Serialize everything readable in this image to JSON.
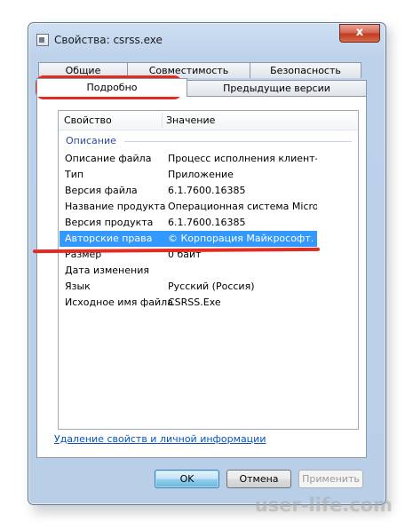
{
  "window": {
    "title": "Свойства: csrss.exe",
    "close_label": "x"
  },
  "tabs": {
    "row1": [
      "Общие",
      "Совместимость",
      "Безопасность"
    ],
    "row2": [
      "Подробно",
      "Предыдущие версии"
    ],
    "active": "Подробно"
  },
  "details": {
    "columns": {
      "property": "Свойство",
      "value": "Значение"
    },
    "group": "Описание",
    "rows": [
      {
        "property": "Описание файла",
        "value": "Процесс исполнения клиент-се..."
      },
      {
        "property": "Тип",
        "value": "Приложение"
      },
      {
        "property": "Версия файла",
        "value": "6.1.7600.16385"
      },
      {
        "property": "Название продукта",
        "value": "Операционная система Microso..."
      },
      {
        "property": "Версия продукта",
        "value": "6.1.7600.16385"
      },
      {
        "property": "Авторские права",
        "value": "© Корпорация Майкрософт. Вс..."
      },
      {
        "property": "Размер",
        "value": "0 байт"
      },
      {
        "property": "Дата изменения",
        "value": ""
      },
      {
        "property": "Язык",
        "value": "Русский (Россия)"
      },
      {
        "property": "Исходное имя файла",
        "value": "CSRSS.Exe"
      }
    ],
    "selected_row": 5
  },
  "link": "Удаление свойств и личной информации",
  "buttons": {
    "ok": "OK",
    "cancel": "Отмена",
    "apply": "Применить"
  },
  "watermark": "user-life.com",
  "colors": {
    "highlight": "#e32b24",
    "selection": "#3399ff",
    "link": "#0a53b8"
  }
}
